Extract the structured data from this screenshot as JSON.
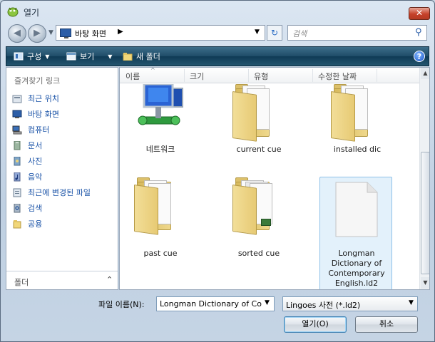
{
  "window": {
    "title": "열기"
  },
  "address": {
    "location": "바탕 화면"
  },
  "search": {
    "placeholder": "검색"
  },
  "toolbar": {
    "organize": "구성",
    "view": "보기",
    "new_folder": "새 폴더"
  },
  "navpane": {
    "favorites_title": "즐겨찾기 링크",
    "items": [
      {
        "label": "최근 위치",
        "icon": "recent-places-icon"
      },
      {
        "label": "바탕 화면",
        "icon": "desktop-icon"
      },
      {
        "label": "컴퓨터",
        "icon": "computer-icon"
      },
      {
        "label": "문서",
        "icon": "documents-icon"
      },
      {
        "label": "사진",
        "icon": "pictures-icon"
      },
      {
        "label": "음악",
        "icon": "music-icon"
      },
      {
        "label": "최근에 변경된 파일",
        "icon": "recently-changed-icon"
      },
      {
        "label": "검색",
        "icon": "searches-icon"
      },
      {
        "label": "공용",
        "icon": "public-icon"
      }
    ],
    "folders_label": "폴더"
  },
  "columns": [
    "이름",
    "크기",
    "유형",
    "수정한 날짜"
  ],
  "items": [
    {
      "label": "네트워크",
      "type": "network"
    },
    {
      "label": "current cue",
      "type": "folder"
    },
    {
      "label": "installed dic",
      "type": "folder"
    },
    {
      "label": "past cue",
      "type": "folder"
    },
    {
      "label": "sorted cue",
      "type": "folder"
    },
    {
      "label": "Longman\nDictionary of\nContemporary\nEnglish.ld2",
      "type": "file",
      "selected": true
    }
  ],
  "footer": {
    "filename_label": "파일 이름(N):",
    "filename_value": "Longman Dictionary of Co",
    "filetype_value": "Lingoes 사전 (*.ld2)",
    "open_button": "열기(O)",
    "cancel_button": "취소"
  }
}
